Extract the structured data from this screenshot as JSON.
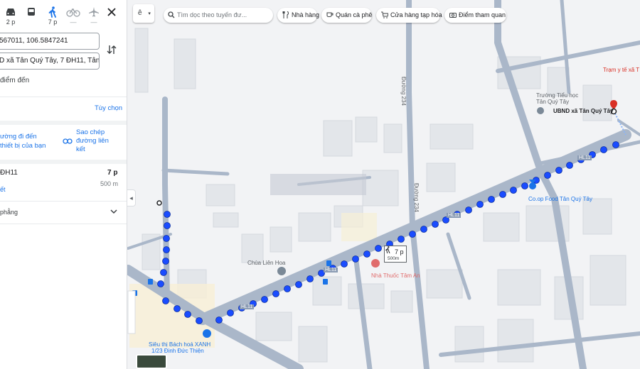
{
  "panel": {
    "modes": [
      {
        "name": "drive",
        "time": "2 p"
      },
      {
        "name": "transit",
        "time": ""
      },
      {
        "name": "walk",
        "time": "7 p"
      },
      {
        "name": "bicycle",
        "time": "—"
      },
      {
        "name": "flight",
        "time": "—"
      }
    ],
    "origin_value": "567011, 106.5847241",
    "destination_value": "D xã Tân Quý Tây, 7 ĐH11, Tân Quý T",
    "add_destination": "điểm đến",
    "options_label": "Tùy chọn",
    "share_label": "ường đi đến thiết bị của bạn",
    "copy_link_label": "Sao chép đường liên kết",
    "route": {
      "name": "ĐH11",
      "time": "7 p",
      "distance": "500 m",
      "details": "ết"
    },
    "flat_label": "phẳng"
  },
  "topbar": {
    "lang": "ê",
    "search_placeholder": "Tìm dọc theo tuyến đư...",
    "chips": [
      "Nhà hàng",
      "Quán cà phê",
      "Cửa hàng tạp hóa",
      "Điểm tham quan"
    ]
  },
  "map": {
    "labels": {
      "tram_y_te": "Trạm y tế xã T",
      "truong_tieu_hoc": "Trường Tiểu học Tân Quý Tây",
      "ubnd": "UBND xã Tân Quý Tây",
      "coop": "Co.op Food Tân Quý Tây",
      "nha_thuoc": "Nhà Thuốc Tâm An",
      "chua": "Chùa Liên Hoa",
      "sieu_thi": "Siêu thị Bách hoá XANH",
      "sieu_thi_addr": "1/23 Đinh Đức Thiện",
      "duong_234_a": "Đường 234",
      "duong_234_b": "Đường 234",
      "hl11_a": "HL11",
      "hl11_b": "HL11",
      "hl11_c": "HL11",
      "hl11_d": "HL11"
    },
    "walk_box": {
      "time": "7 p",
      "distance": "500m"
    }
  },
  "colors": {
    "route": "#1a5cff",
    "road": "#aab7c9",
    "accent": "#1a73e8"
  }
}
